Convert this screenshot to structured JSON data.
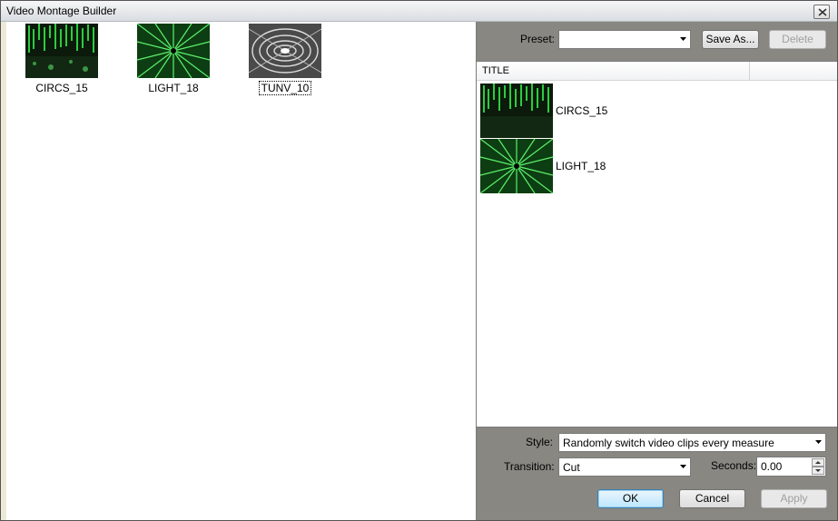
{
  "window": {
    "title": "Video Montage Builder",
    "close_icon": "close-icon"
  },
  "clips": [
    {
      "label": "CIRCS_15",
      "thumb": "matrix-green"
    },
    {
      "label": "LIGHT_18",
      "thumb": "burst-green"
    },
    {
      "label": "TUNV_10",
      "thumb": "tunnel-gray"
    }
  ],
  "preset": {
    "label": "Preset:",
    "value": "",
    "save_label": "Save As...",
    "delete_label": "Delete"
  },
  "list": {
    "column": "TITLE",
    "rows": [
      {
        "label": "CIRCS_15",
        "thumb": "matrix-green"
      },
      {
        "label": "LIGHT_18",
        "thumb": "burst-green"
      }
    ]
  },
  "style": {
    "label": "Style:",
    "value": "Randomly switch video clips every measure"
  },
  "transition": {
    "label": "Transition:",
    "value": "Cut"
  },
  "seconds": {
    "label": "Seconds:",
    "value": "0.00"
  },
  "buttons": {
    "ok": "OK",
    "cancel": "Cancel",
    "apply": "Apply"
  },
  "colors": {
    "accent_green": "#2ecc40",
    "panel_gray": "#888782",
    "default_button_border": "#3c7fb1"
  }
}
